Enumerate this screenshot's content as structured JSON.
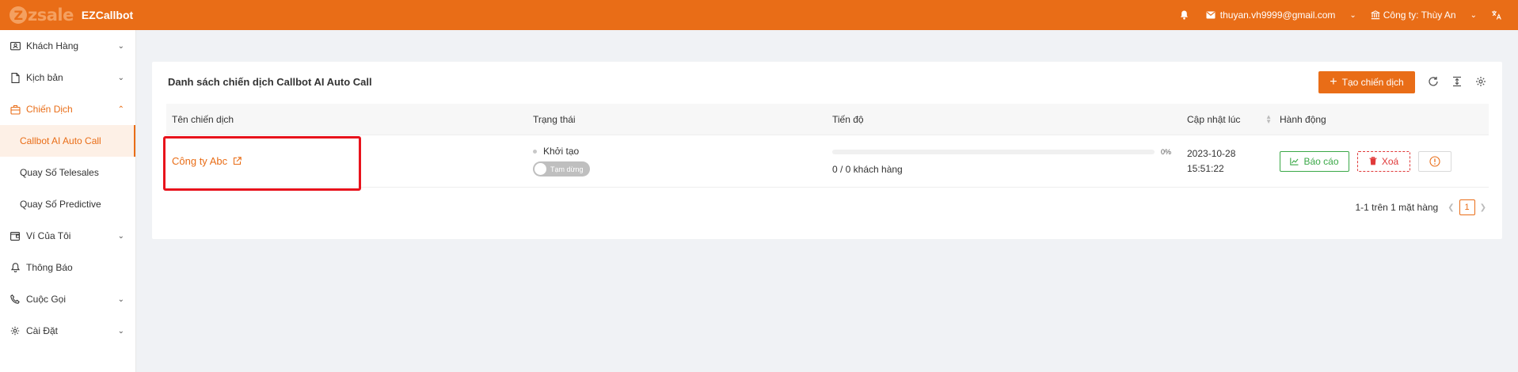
{
  "brand": {
    "logo_text": "zsale",
    "app_name": "EZCallbot"
  },
  "header": {
    "email": "thuyan.vh9999@gmail.com",
    "company": "Công ty: Thùy An"
  },
  "sidebar": {
    "items": [
      {
        "label": "Khách Hàng",
        "icon": "contact-card-icon"
      },
      {
        "label": "Kịch bản",
        "icon": "document-icon"
      },
      {
        "label": "Chiến Dịch",
        "icon": "campaign-icon"
      },
      {
        "label": "Ví Của Tôi",
        "icon": "wallet-icon"
      },
      {
        "label": "Thông Báo",
        "icon": "bell-icon"
      },
      {
        "label": "Cuộc Gọi",
        "icon": "phone-icon"
      },
      {
        "label": "Cài Đặt",
        "icon": "gear-icon"
      }
    ],
    "sub_items": [
      {
        "label": "Callbot AI Auto Call"
      },
      {
        "label": "Quay Số Telesales"
      },
      {
        "label": "Quay Số Predictive"
      }
    ]
  },
  "main": {
    "title": "Danh sách chiến dịch Callbot AI Auto Call",
    "create_button": "Tạo chiến dịch",
    "columns": [
      "Tên chiến dịch",
      "Trạng thái",
      "Tiến độ",
      "Cập nhật lúc",
      "Hành động"
    ],
    "rows": [
      {
        "name": "Công ty Abc",
        "status": "Khởi tạo",
        "toggle_label": "Tạm dừng",
        "progress_percent": 0,
        "progress_label": "0%",
        "progress_text": "0 / 0 khách hàng",
        "updated_date": "2023-10-28",
        "updated_time": "15:51:22",
        "report_label": "Báo cáo",
        "delete_label": "Xoá"
      }
    ],
    "pagination": {
      "summary": "1-1 trên 1 mặt hàng",
      "current_page": "1"
    }
  },
  "colors": {
    "accent": "#e96d17",
    "highlight": "#e8131c",
    "success": "#3aa847",
    "danger": "#e03a3a"
  }
}
